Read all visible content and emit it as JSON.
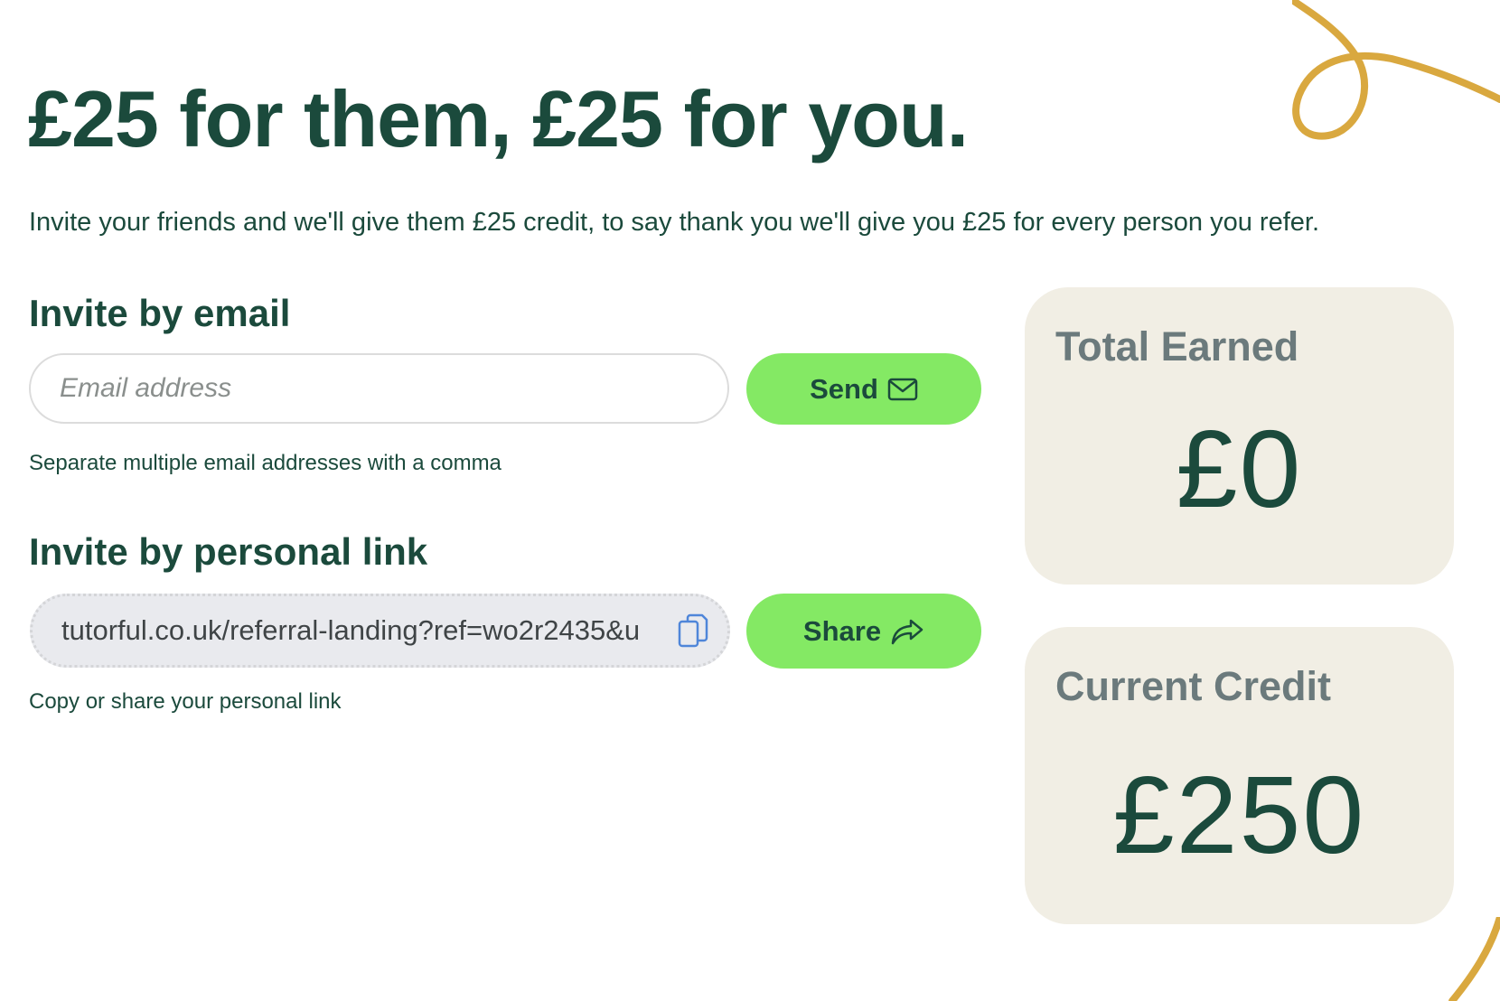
{
  "headline": "£25 for them, £25 for you.",
  "subtitle": "Invite your friends and we'll give them £25 credit, to say thank you we'll give you £25 for every person you refer.",
  "email_section": {
    "heading": "Invite by email",
    "input_placeholder": "Email address",
    "input_value": "",
    "send_label": "Send",
    "send_icon": "envelope-icon",
    "helper": "Separate multiple email addresses with a comma"
  },
  "link_section": {
    "heading": "Invite by personal link",
    "link_value": "tutorful.co.uk/referral-landing?ref=wo2r2435&u",
    "copy_icon": "copy-icon",
    "share_label": "Share",
    "share_icon": "share-arrow-icon",
    "helper": "Copy or share your personal link"
  },
  "stats": {
    "total_earned": {
      "label": "Total Earned",
      "value": "£0"
    },
    "current_credit": {
      "label": "Current Credit",
      "value": "£250"
    }
  },
  "colors": {
    "text_primary": "#1b4a3c",
    "accent_button": "#84e964",
    "card_background": "#f1eee4",
    "card_label": "#6b7a7c",
    "doodle": "#d9a83f",
    "copy_icon": "#4f86d9"
  }
}
